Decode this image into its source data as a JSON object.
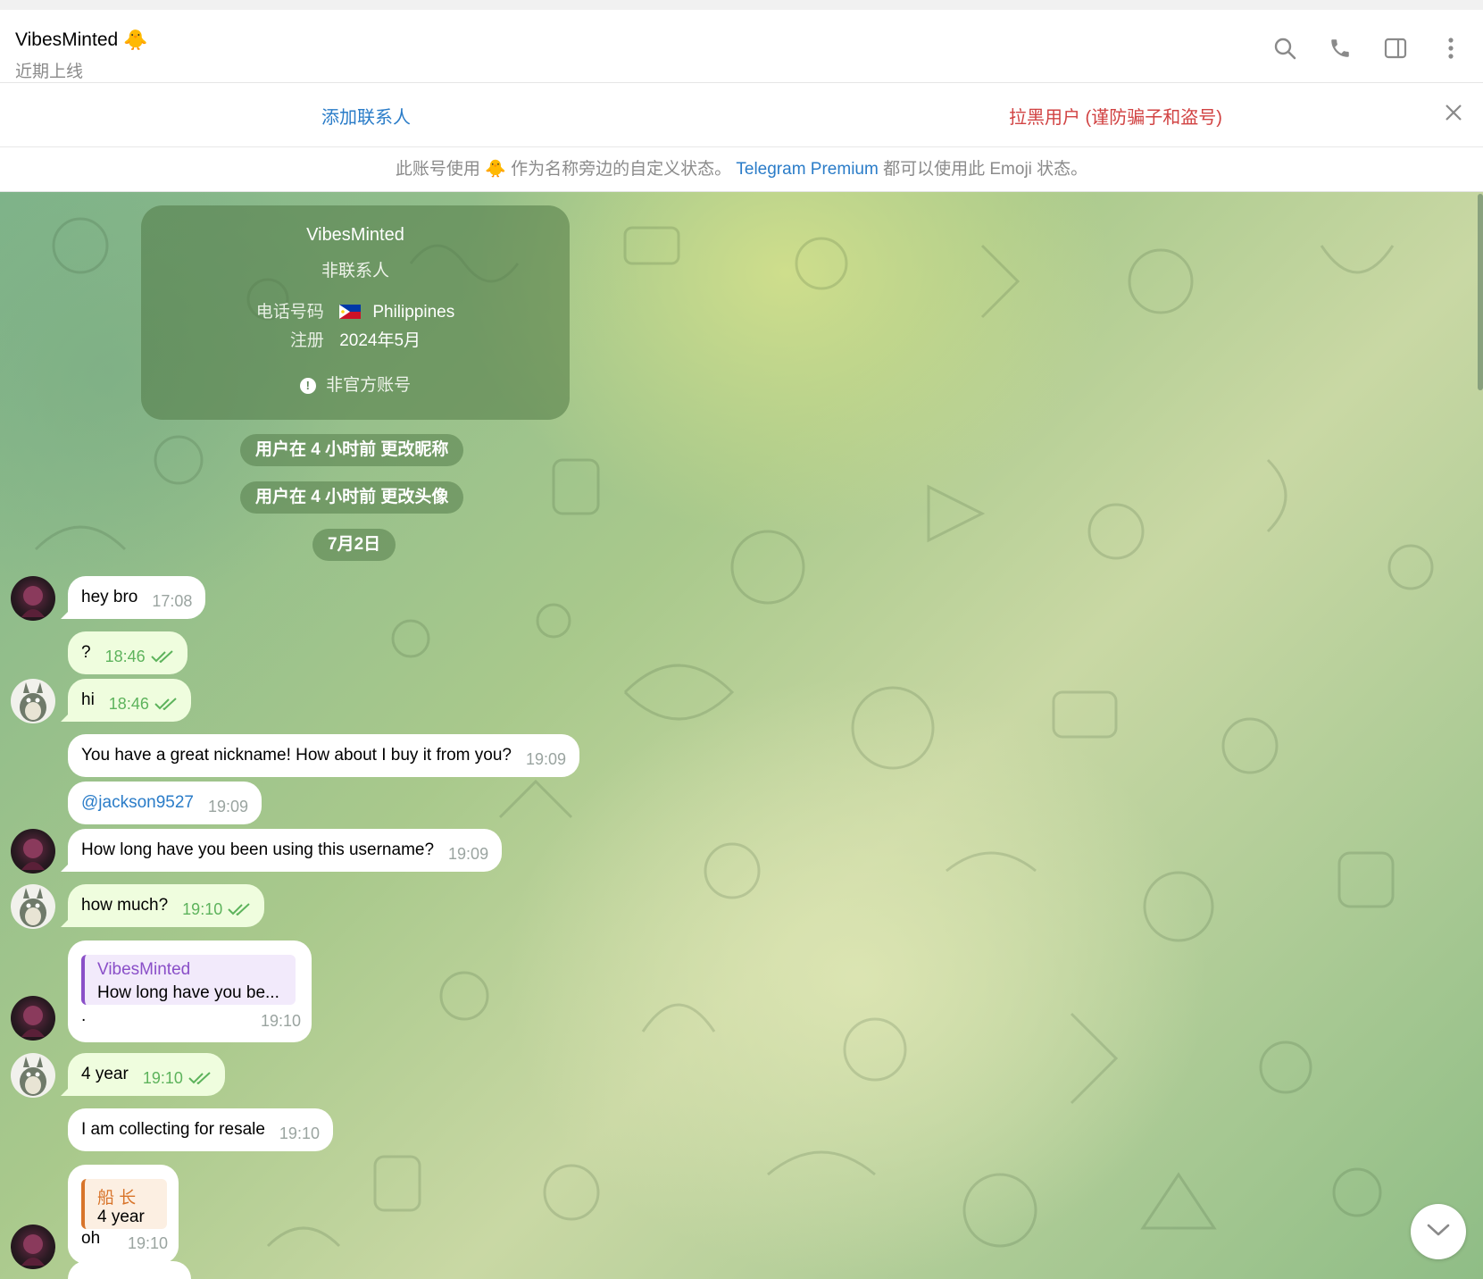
{
  "header": {
    "title": "VibesMinted",
    "title_emoji": "🐥",
    "status": "近期上线"
  },
  "icons": {
    "search": "search-icon",
    "call": "phone-icon",
    "sidebar": "sidebar-toggle-icon",
    "more": "more-vertical-icon",
    "close": "close-icon",
    "scroll_down": "chevron-down-icon"
  },
  "action_bar": {
    "add_contact": "添加联系人",
    "block_user": "拉黑用户 (谨防骗子和盗号)"
  },
  "info_bar": {
    "prefix": "此账号使用",
    "emoji": "🐥",
    "middle": "作为名称旁边的自定义状态。",
    "link": "Telegram Premium",
    "suffix": "都可以使用此 Emoji 状态。"
  },
  "info_card": {
    "name": "VibesMinted",
    "subtitle": "非联系人",
    "phone_label": "电话号码",
    "phone_value": "Philippines",
    "registered_label": "注册",
    "registered_value": "2024年5月",
    "unofficial": "非官方账号"
  },
  "service_messages": [
    "用户在 4 小时前 更改昵称",
    "用户在 4 小时前 更改头像",
    "7月2日"
  ],
  "messages": [
    {
      "text": "hey bro",
      "time": "17:08",
      "outgoing": false
    },
    {
      "text": "?",
      "time": "18:46",
      "outgoing": true
    },
    {
      "text": "hi",
      "time": "18:46",
      "outgoing": true
    },
    {
      "text": "You have a great nickname! How about I buy it from you?",
      "time": "19:09",
      "outgoing": false
    },
    {
      "text": "@jackson9527",
      "time": "19:09",
      "outgoing": false
    },
    {
      "text": "How long have you been using this username?",
      "time": "19:09",
      "outgoing": false
    },
    {
      "text": "how much?",
      "time": "19:10",
      "outgoing": true
    },
    {
      "reply_name": "VibesMinted",
      "reply_text": "How long have you be...",
      "text": ".",
      "time": "19:10",
      "outgoing": false
    },
    {
      "text": "4 year",
      "time": "19:10",
      "outgoing": true
    },
    {
      "text": "I am collecting for resale",
      "time": "19:10",
      "outgoing": false
    },
    {
      "reply_name": "船 长",
      "reply_text": "4 year",
      "text": "oh",
      "time": "19:10",
      "outgoing": false
    }
  ],
  "colors": {
    "link": "#2a7cc8",
    "danger": "#d14242",
    "outgoing_bubble": "#effdde",
    "check": "#5db35c",
    "reply_purple": "#8a4fc8",
    "reply_orange": "#d8742a"
  }
}
